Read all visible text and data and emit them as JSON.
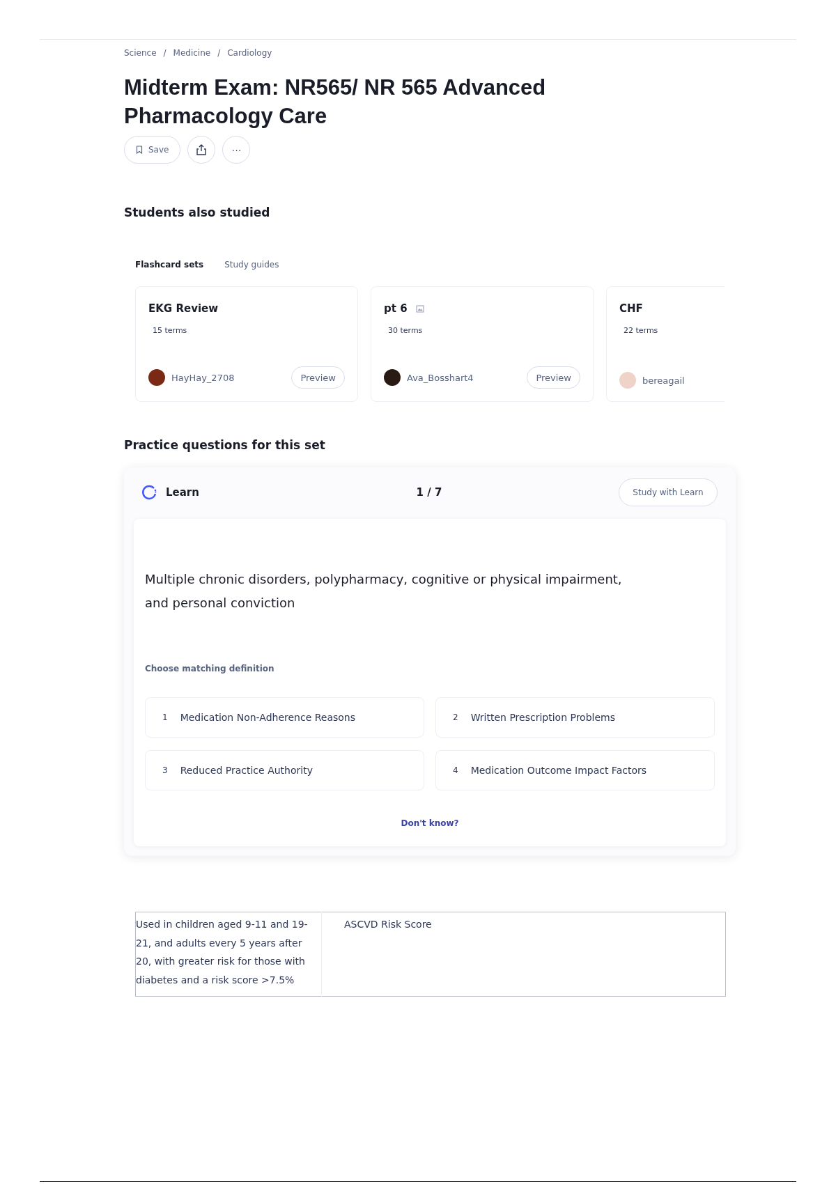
{
  "breadcrumbs": [
    "Science",
    "Medicine",
    "Cardiology"
  ],
  "breadcrumb_separator": "/",
  "title": "Midterm Exam: NR565/ NR 565 Advanced Pharmacology Care",
  "actions": {
    "save": "Save",
    "more": "···"
  },
  "also_studied": {
    "heading": "Students also studied",
    "tabs": [
      {
        "label": "Flashcard sets",
        "selected": true
      },
      {
        "label": "Study guides",
        "selected": false
      }
    ],
    "cards": [
      {
        "title": "EKG Review",
        "has_image": false,
        "terms": "15 terms",
        "author": "HayHay_2708",
        "preview": "Preview"
      },
      {
        "title": "pt 6",
        "has_image": true,
        "terms": "30 terms",
        "author": "Ava_Bosshart4",
        "preview": "Preview"
      },
      {
        "title": "CHF",
        "has_image": false,
        "terms": "22 terms",
        "author": "bereagail"
      }
    ]
  },
  "practice": {
    "heading": "Practice questions for this set",
    "mode": "Learn",
    "progress": "1 / 7",
    "study_button": "Study with Learn",
    "question": "Multiple chronic disorders, polypharmacy, cognitive or physical impairment, and personal conviction",
    "prompt": "Choose matching definition",
    "options": [
      {
        "number": "1",
        "text": "Medication Non-Adherence Reasons"
      },
      {
        "number": "2",
        "text": "Written Prescription Problems"
      },
      {
        "number": "3",
        "text": "Reduced Practice Authority"
      },
      {
        "number": "4",
        "text": "Medication Outcome Impact Factors"
      }
    ],
    "dont_know": "Don't know?"
  },
  "terms_table": {
    "rows": [
      {
        "definition": "Used in children aged 9-11 and 19-21, and adults every 5 years after 20, with greater risk for those with diabetes and a risk score >7.5%",
        "term": "ASCVD Risk Score"
      }
    ]
  }
}
